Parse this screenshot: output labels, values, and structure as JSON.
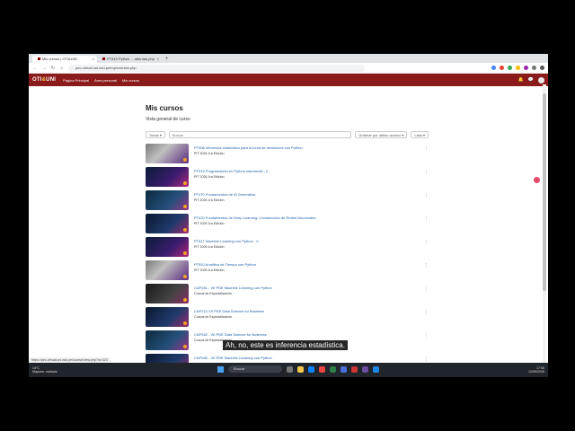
{
  "browser": {
    "tabs": [
      {
        "label": "Mis cursos | OTI&UNI",
        "active": true
      },
      {
        "label": "PT519 Python ... alternas.php",
        "active": false
      }
    ],
    "url": "pec-virtual.uni.edu.pe/my/courses.php"
  },
  "site": {
    "logo_left": "OTI",
    "logo_amp": "&",
    "logo_right": "UNI",
    "nav": [
      "Página Principal",
      "Área personal",
      "Mis cursos"
    ]
  },
  "page": {
    "title": "Mis cursos",
    "subtitle": "Vista general de curso",
    "filter_all": "Todos",
    "search_placeholder": "Buscar",
    "sort": "Ordenar por último acceso",
    "view": "Lista"
  },
  "courses": [
    {
      "title": "PT506 Inferencia estadística para la toma de decisiones con Python",
      "sub": "PIT 2026 1ra Edición",
      "thumb": "t1"
    },
    {
      "title": "PT519 Programación en Python intermedio - II",
      "sub": "PIT 2026 1ra Edición",
      "thumb": "t2"
    },
    {
      "title": "PT470 Fundamentos de IA Generativa",
      "sub": "PIT 2026 1ra Edición",
      "thumb": "t3"
    },
    {
      "title": "PT420 Fundamentos de Deep Learning: Construcción de Redes Neuronales",
      "sub": "PIT 2026 1ra Edición",
      "thumb": "t5"
    },
    {
      "title": "PT517 Machine Learning con Python - II",
      "sub": "PIT 2026 1ra Edición",
      "thumb": "t2"
    },
    {
      "title": "PT510 Analítica de Tiempo con Python",
      "sub": "PIT 2026 1ra Edición",
      "thumb": "t1"
    },
    {
      "title": "CAP281 - VII PDE Machine Learning con Python",
      "sub": "Cursos de Especialización",
      "thumb": "t4"
    },
    {
      "title": "CAP213 VII PDE Data Science for Business",
      "sub": "Cursos de Especialización",
      "thumb": "t5"
    },
    {
      "title": "CAP282 - VII PDE Data Science for Business",
      "sub": "Cursos de Especialización",
      "thumb": "t3"
    },
    {
      "title": "CAP280 - VII PDE Machine Learning con Python",
      "sub": "",
      "thumb": "t5"
    }
  ],
  "overlay": {
    "subtitle": "Ah, no, este es inferencia estadística.",
    "status_url": "https://pec-virtual.uni.edu.pe/course/view.php?id=323"
  },
  "taskbar": {
    "weather_temp": "14°C",
    "weather_desc": "Mayorm. nublado",
    "search": "Buscar",
    "time": "17:06",
    "date": "12/05/2026"
  },
  "colors": {
    "brand": "#8b1a1a",
    "link": "#1a5fa8"
  }
}
